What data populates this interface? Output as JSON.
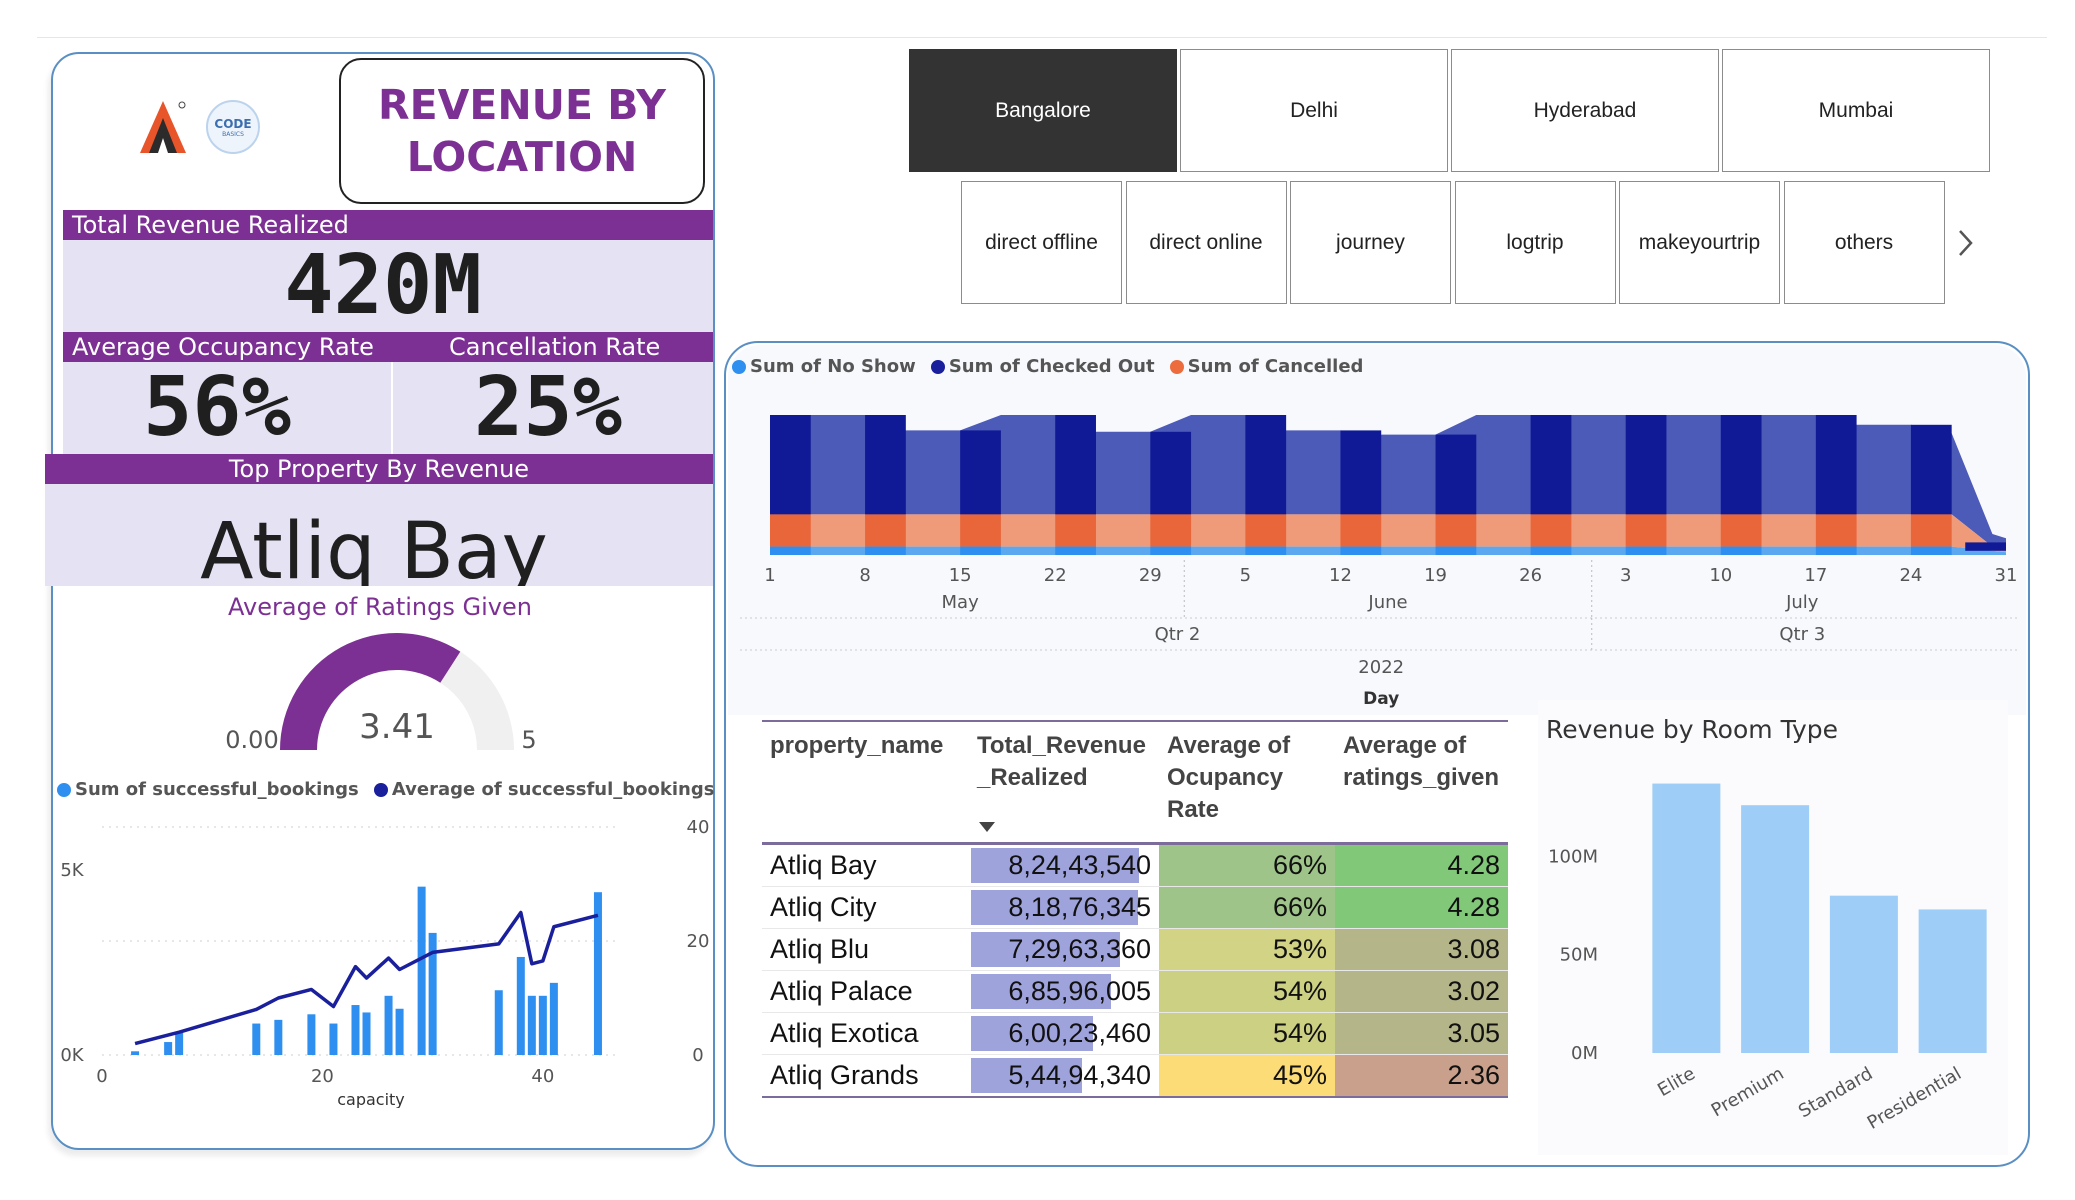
{
  "header": {
    "title": "REVENUE BY LOCATION",
    "logo_text": "CODE",
    "logo_subtext": "BASICS"
  },
  "kpis": {
    "revenue_label": "Total Revenue Realized",
    "revenue_value": "420M",
    "occupancy_label": "Average Occupancy Rate",
    "occupancy_value": "56%",
    "cancellation_label": "Cancellation Rate",
    "cancellation_value": "25%",
    "top_property_label": "Top Property By Revenue",
    "top_property_value": "Atliq Bay"
  },
  "cities": {
    "items": [
      "Bangalore",
      "Delhi",
      "Hyderabad",
      "Mumbai"
    ],
    "selected": "Bangalore"
  },
  "platforms": {
    "items": [
      "direct offline",
      "direct online",
      "journey",
      "logtrip",
      "makeyourtrip",
      "others"
    ],
    "next_icon": "chevron-right-icon"
  },
  "colors": {
    "accent": "#7c3093",
    "kpi_bg": "#e5e2f3",
    "no_show": "#2e8ff0",
    "checked_out": "#1a1f9c",
    "cancelled": "#ec6c3e",
    "bar_light": "#9ecdf7",
    "databar": "#9fa3dc"
  },
  "chart_data": [
    {
      "type": "gauge",
      "title": "Average of Ratings Given",
      "value": 3.41,
      "min_label": "0.00",
      "max_label": "5",
      "range": [
        0,
        5
      ]
    },
    {
      "type": "bar",
      "combo_line": true,
      "legend": [
        "Sum of successful_bookings",
        "Average of successful_bookings"
      ],
      "xlabel": "capacity",
      "x_ticks": [
        0,
        20,
        40
      ],
      "y_left_ticks": [
        "0K",
        "5K"
      ],
      "y_right_ticks": [
        0,
        20,
        40
      ],
      "bars": [
        {
          "x": 3,
          "y": 100
        },
        {
          "x": 6,
          "y": 350
        },
        {
          "x": 7,
          "y": 600
        },
        {
          "x": 14,
          "y": 850
        },
        {
          "x": 16,
          "y": 950
        },
        {
          "x": 19,
          "y": 1100
        },
        {
          "x": 21,
          "y": 850
        },
        {
          "x": 23,
          "y": 1350
        },
        {
          "x": 24,
          "y": 1150
        },
        {
          "x": 26,
          "y": 1600
        },
        {
          "x": 27,
          "y": 1250
        },
        {
          "x": 29,
          "y": 4550
        },
        {
          "x": 30,
          "y": 3300
        },
        {
          "x": 36,
          "y": 1750
        },
        {
          "x": 38,
          "y": 2650
        },
        {
          "x": 39,
          "y": 1600
        },
        {
          "x": 40,
          "y": 1600
        },
        {
          "x": 41,
          "y": 1950
        },
        {
          "x": 45,
          "y": 4400
        }
      ],
      "line": [
        {
          "x": 3,
          "y": 2
        },
        {
          "x": 7,
          "y": 4
        },
        {
          "x": 14,
          "y": 8
        },
        {
          "x": 16,
          "y": 10
        },
        {
          "x": 19,
          "y": 11.5
        },
        {
          "x": 21,
          "y": 8.5
        },
        {
          "x": 23,
          "y": 15.5
        },
        {
          "x": 24,
          "y": 13.5
        },
        {
          "x": 26,
          "y": 17
        },
        {
          "x": 27,
          "y": 15
        },
        {
          "x": 30,
          "y": 18
        },
        {
          "x": 36,
          "y": 19.5
        },
        {
          "x": 38,
          "y": 25
        },
        {
          "x": 39,
          "y": 16
        },
        {
          "x": 40,
          "y": 16.5
        },
        {
          "x": 41,
          "y": 22.5
        },
        {
          "x": 45,
          "y": 24.5
        }
      ],
      "ylim_left": [
        0,
        5000
      ],
      "ylim_right": [
        0,
        40
      ],
      "xlim": [
        0,
        47
      ]
    },
    {
      "type": "area",
      "stacked": true,
      "legend": [
        "Sum of No Show",
        "Sum of Checked Out",
        "Sum of Cancelled"
      ],
      "x_tick_labels": [
        "1",
        "8",
        "15",
        "22",
        "29",
        "5",
        "12",
        "19",
        "26",
        "3",
        "10",
        "17",
        "24",
        "31"
      ],
      "months": [
        "May",
        "June",
        "July"
      ],
      "quarters": [
        "Qtr 2",
        "Qtr 3"
      ],
      "year": "2022",
      "xlabel": "Day",
      "ylim": [
        0,
        100
      ],
      "x_days": [
        1,
        4,
        8,
        11,
        15,
        18,
        22,
        25,
        29,
        32,
        36,
        39,
        43,
        46,
        50,
        53,
        57,
        60,
        64,
        67,
        71,
        74,
        78,
        81,
        85,
        88,
        91,
        92
      ],
      "series": [
        {
          "name": "Sum of No Show",
          "values": [
            6,
            6,
            6,
            6,
            6,
            6,
            6,
            6,
            6,
            6,
            6,
            6,
            6,
            6,
            6,
            6,
            6,
            6,
            6,
            6,
            6,
            6,
            6,
            6,
            6,
            6,
            3,
            2
          ]
        },
        {
          "name": "Sum of Cancelled",
          "values": [
            23,
            23,
            23,
            23,
            23,
            23,
            23,
            23,
            23,
            23,
            23,
            23,
            23,
            23,
            23,
            23,
            23,
            23,
            23,
            23,
            23,
            23,
            23,
            23,
            23,
            23,
            3,
            2
          ]
        },
        {
          "name": "Sum of Checked Out",
          "values": [
            71,
            71,
            71,
            60,
            60,
            71,
            71,
            59,
            59,
            71,
            71,
            60,
            60,
            57,
            57,
            71,
            71,
            71,
            71,
            71,
            71,
            71,
            71,
            64,
            64,
            58,
            9,
            8
          ]
        }
      ]
    },
    {
      "type": "table",
      "columns": [
        "property_name",
        "Total_Revenue_Realized",
        "Average of Ocupancy Rate",
        "Average of ratings_given"
      ],
      "rows": [
        {
          "property_name": "Atliq Bay",
          "revenue": "8,24,43,540",
          "revenue_value": 82443540,
          "occupancy": "66%",
          "rating": "4.28"
        },
        {
          "property_name": "Atliq City",
          "revenue": "8,18,76,345",
          "revenue_value": 81876345,
          "occupancy": "66%",
          "rating": "4.28"
        },
        {
          "property_name": "Atliq Blu",
          "revenue": "7,29,63,360",
          "revenue_value": 72963360,
          "occupancy": "53%",
          "rating": "3.08"
        },
        {
          "property_name": "Atliq Palace",
          "revenue": "6,85,96,005",
          "revenue_value": 68596005,
          "occupancy": "54%",
          "rating": "3.02"
        },
        {
          "property_name": "Atliq Exotica",
          "revenue": "6,00,23,460",
          "revenue_value": 60023460,
          "occupancy": "54%",
          "rating": "3.05"
        },
        {
          "property_name": "Atliq Grands",
          "revenue": "5,44,94,340",
          "revenue_value": 54494340,
          "occupancy": "45%",
          "rating": "2.36"
        }
      ],
      "occupancy_colors": [
        "#9ec48a",
        "#9ec48a",
        "#d3d386",
        "#ccd082",
        "#ccd082",
        "#fcdc76"
      ],
      "rating_colors": [
        "#82c879",
        "#82c879",
        "#b5b58a",
        "#b5b58a",
        "#b5b58a",
        "#c9a08b"
      ]
    },
    {
      "type": "bar",
      "title": "Revenue by Room Type",
      "categories": [
        "Elite",
        "Premium",
        "Standard",
        "Presidential"
      ],
      "values": [
        137,
        126,
        80,
        73
      ],
      "y_ticks": [
        "0M",
        "50M",
        "100M"
      ],
      "ylim": [
        0,
        150
      ]
    }
  ]
}
